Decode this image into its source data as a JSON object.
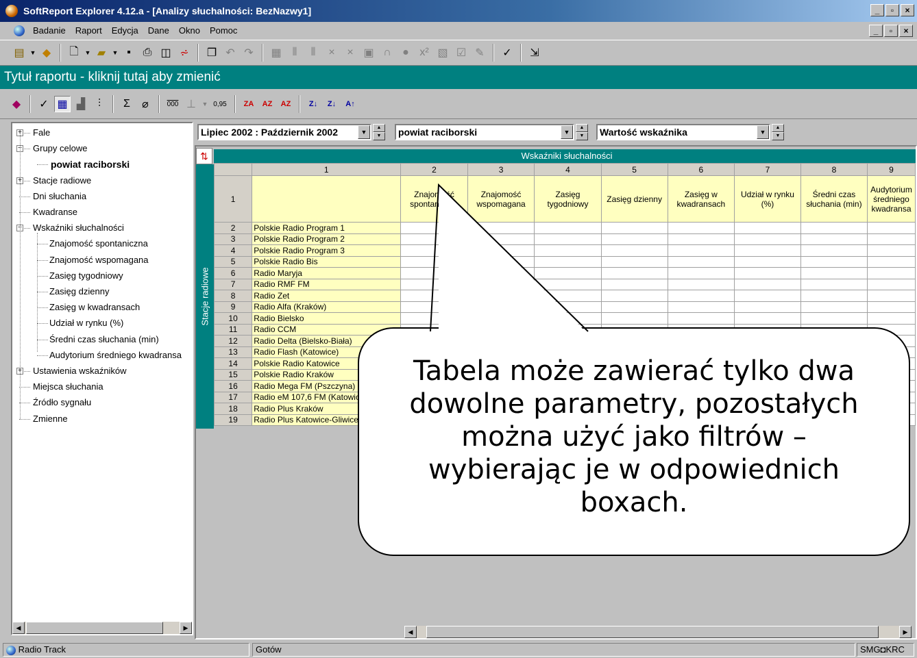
{
  "window": {
    "title": "SoftReport Explorer 4.12.a - [Analizy słuchalności: BezNazwy1]",
    "controls": [
      "_",
      "▫",
      "×"
    ]
  },
  "menu": [
    "Badanie",
    "Raport",
    "Edycja",
    "Dane",
    "Okno",
    "Pomoc"
  ],
  "toolbar1_icons": [
    "open-report-icon",
    "open-study-icon",
    "new-icon",
    "open-icon",
    "save-icon",
    "print-icon",
    "print-preview-icon",
    "filter-icon",
    "copy-icon",
    "undo-icon",
    "redo-icon",
    "calculator-icon",
    "columns-icon",
    "rows-icon",
    "delete-icon",
    "clear-icon",
    "radio-icon",
    "headphones-icon",
    "record-icon",
    "power-icon",
    "compare-icon",
    "check-list-icon",
    "wizard-icon",
    "check-icon",
    "export-icon"
  ],
  "report_title": "Tytuł raportu - kliknij tutaj aby zmienić",
  "toolbar2": {
    "decimal_label": "0,95",
    "thousands_label": "000"
  },
  "tree": {
    "items": [
      {
        "label": "Fale",
        "level": 0,
        "expander": "+"
      },
      {
        "label": "Grupy celowe",
        "level": 0,
        "expander": "-"
      },
      {
        "label": "powiat raciborski",
        "level": 1,
        "bold": true
      },
      {
        "label": "Stacje radiowe",
        "level": 0,
        "expander": "+"
      },
      {
        "label": "Dni słuchania",
        "level": 0
      },
      {
        "label": "Kwadranse",
        "level": 0
      },
      {
        "label": "Wskaźniki słuchalności",
        "level": 0,
        "expander": "-"
      },
      {
        "label": "Znajomość spontaniczna",
        "level": 1
      },
      {
        "label": "Znajomość wspomagana",
        "level": 1
      },
      {
        "label": "Zasięg tygodniowy",
        "level": 1
      },
      {
        "label": "Zasięg dzienny",
        "level": 1
      },
      {
        "label": "Zasięg w kwadransach",
        "level": 1
      },
      {
        "label": "Udział w rynku (%)",
        "level": 1
      },
      {
        "label": "Średni czas słuchania (min)",
        "level": 1
      },
      {
        "label": "Audytorium średniego kwadransa",
        "level": 1
      },
      {
        "label": "Ustawienia wskaźników",
        "level": 0,
        "expander": "+"
      },
      {
        "label": "Miejsca słuchania",
        "level": 0
      },
      {
        "label": "Źródło sygnału",
        "level": 0
      },
      {
        "label": "Zmienne",
        "level": 0
      }
    ]
  },
  "filters": {
    "period": "Lipiec 2002 : Październik 2002",
    "target_group": "powiat raciborski",
    "value_type": "Wartość wskaźnika"
  },
  "table": {
    "column_group": "Wskaźniki słuchalności",
    "row_group": "Stacje radiowe",
    "column_numbers": [
      "1",
      "2",
      "3",
      "4",
      "5",
      "6",
      "7",
      "8",
      "9"
    ],
    "header_row_number": "1",
    "headers": [
      "Znajomość spontaniczna",
      "Znajomość wspomagana",
      "Zasięg tygodniowy",
      "Zasięg dzienny",
      "Zasięg w kwadransach",
      "Udział w rynku (%)",
      "Średni czas słuchania (min)",
      "Audytorium średniego kwadransa"
    ],
    "rows": [
      {
        "num": "2",
        "name": "Polskie Radio Program 1"
      },
      {
        "num": "3",
        "name": "Polskie Radio Program 2"
      },
      {
        "num": "4",
        "name": "Polskie Radio Program 3"
      },
      {
        "num": "5",
        "name": "Polskie Radio Bis"
      },
      {
        "num": "6",
        "name": "Radio Maryja"
      },
      {
        "num": "7",
        "name": "Radio RMF FM"
      },
      {
        "num": "8",
        "name": "Radio Zet"
      },
      {
        "num": "9",
        "name": "Radio Alfa (Kraków)"
      },
      {
        "num": "10",
        "name": "Radio Bielsko"
      },
      {
        "num": "11",
        "name": "Radio CCM"
      },
      {
        "num": "12",
        "name": "Radio Delta (Bielsko-Biała)"
      },
      {
        "num": "13",
        "name": "Radio Flash (Katowice)"
      },
      {
        "num": "14",
        "name": "Polskie Radio Katowice"
      },
      {
        "num": "15",
        "name": "Polskie Radio Kraków"
      },
      {
        "num": "16",
        "name": "Radio Mega FM (Pszczyna)"
      },
      {
        "num": "17",
        "name": "Radio eM 107,6 FM (Katowice)"
      },
      {
        "num": "18",
        "name": "Radio Plus Kraków"
      },
      {
        "num": "19",
        "name": "Radio Plus Katowice-Gliwice"
      }
    ]
  },
  "callout": {
    "text": "Tabela może zawierać tylko dwa dowolne parametry, pozostałych można użyć jako filtrów – wybierając je w odpowiednich boxach."
  },
  "status": {
    "left": "Radio Track",
    "middle": "Gotów",
    "right": "SMG◘KRC"
  },
  "colors": {
    "teal": "#008080",
    "header_yellow": "#ffffc0",
    "title_blue": "#0a246a"
  }
}
